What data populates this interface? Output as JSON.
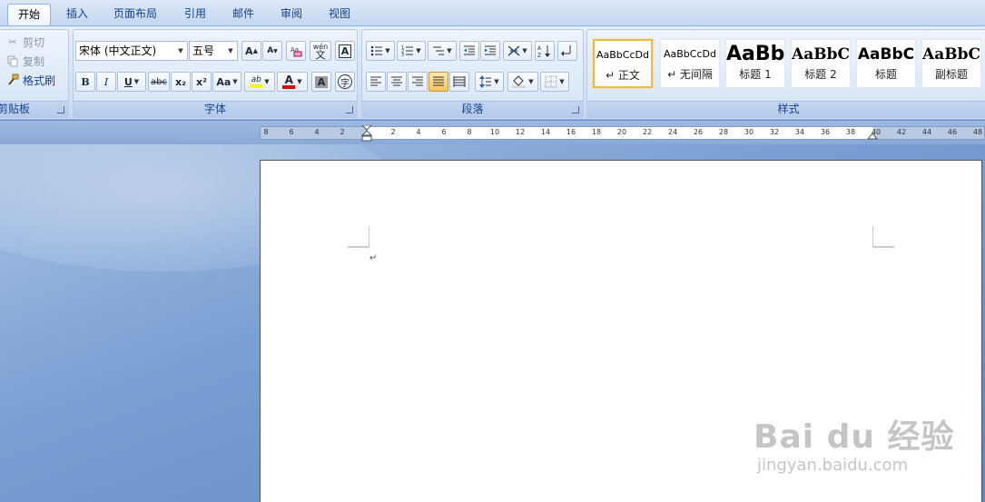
{
  "tabs": [
    "开始",
    "插入",
    "页面布局",
    "引用",
    "邮件",
    "审阅",
    "视图"
  ],
  "active_tab": "开始",
  "clipboard": {
    "label": "剪贴板",
    "cut": "剪切",
    "copy": "复制",
    "format_painter": "格式刷"
  },
  "font": {
    "label": "字体",
    "font_name": "宋体 (中文正文)",
    "font_size": "五号",
    "bold": "B",
    "italic": "I",
    "underline": "U",
    "strikethrough": "abc",
    "subscript": "x₂",
    "superscript": "x²",
    "change_case": "Aa",
    "grow": "A",
    "shrink": "A",
    "char_border": "A",
    "char_shading": "A",
    "wen": "wén",
    "wen_char": "文",
    "enclose": "字",
    "font_color": "A",
    "highlight": "ab"
  },
  "paragraph": {
    "label": "段落"
  },
  "styles": {
    "label": "样式",
    "items": [
      {
        "sample": "AaBbCcDd",
        "name": "↵ 正文"
      },
      {
        "sample": "AaBbCcDd",
        "name": "↵ 无间隔"
      },
      {
        "sample": "AaBb",
        "name": "标题 1"
      },
      {
        "sample": "AaBbC",
        "name": "标题 2"
      },
      {
        "sample": "AaBbC",
        "name": "标题"
      },
      {
        "sample": "AaBbC",
        "name": "副标题"
      }
    ]
  },
  "ruler": {
    "left_ticks": [
      "8",
      "6",
      "4",
      "2"
    ],
    "right_ticks": [
      "2",
      "4",
      "6",
      "8",
      "10",
      "12",
      "14",
      "16",
      "18",
      "20",
      "22",
      "24",
      "26",
      "28",
      "30",
      "32",
      "34",
      "36",
      "38",
      "40",
      "42",
      "44",
      "46",
      "48"
    ]
  },
  "document": {
    "paragraph_mark": "↵"
  },
  "watermark": {
    "logo": "Bai du 经验",
    "url": "jingyan.baidu.com"
  },
  "colors": {
    "accent": "#15428b",
    "font_color_bar": "#e00000",
    "highlight_bar": "#ffff00",
    "selected_style_border": "#f2b93f"
  }
}
